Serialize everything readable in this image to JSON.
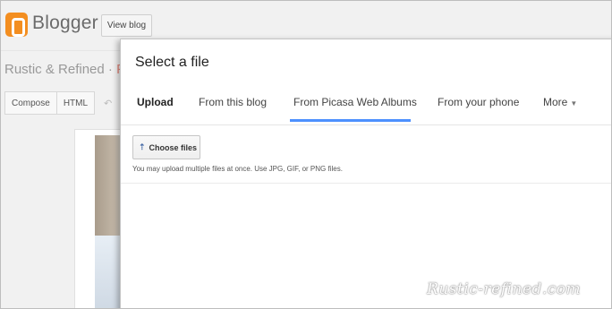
{
  "app": {
    "logo_text": "Blogger",
    "view_blog_label": "View blog"
  },
  "blog": {
    "title": "Rustic & Refined ·",
    "title_accent": "P"
  },
  "editor": {
    "compose_label": "Compose",
    "html_label": "HTML"
  },
  "dialog": {
    "title": "Select a file",
    "tabs": [
      {
        "label": "Upload",
        "active": true
      },
      {
        "label": "From this blog",
        "active": false
      },
      {
        "label": "From Picasa Web Albums",
        "active": false
      },
      {
        "label": "From your phone",
        "active": false
      },
      {
        "label": "More",
        "active": false
      }
    ],
    "choose_files_label": "Choose files",
    "hint": "You may upload multiple files at once. Use JPG, GIF, or PNG files."
  },
  "watermark": "Rustic-refined.com",
  "colors": {
    "brand_orange": "#f38e20",
    "tab_underline": "#4d90fe"
  }
}
